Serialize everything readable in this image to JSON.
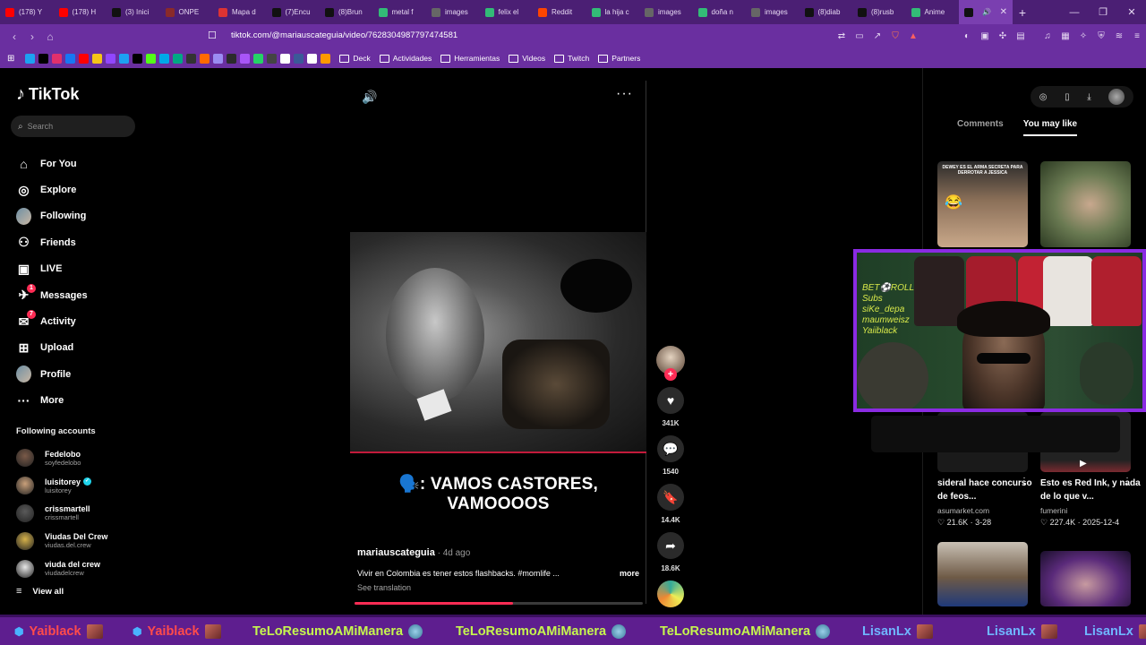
{
  "browser": {
    "tabs": [
      {
        "label": "(178) Y",
        "color": "#ff0000"
      },
      {
        "label": "(178) H",
        "color": "#ff0000"
      },
      {
        "label": "(3) Inici",
        "color": "#111111"
      },
      {
        "label": "ONPE",
        "color": "#8a2a2a"
      },
      {
        "label": "Mapa d",
        "color": "#d33"
      },
      {
        "label": "(7)Encu",
        "color": "#111111"
      },
      {
        "label": "(8)Brun",
        "color": "#111111"
      },
      {
        "label": "metal f",
        "color": "#3b7"
      },
      {
        "label": "images",
        "color": "#666"
      },
      {
        "label": "felix el",
        "color": "#3b7"
      },
      {
        "label": "Reddit",
        "color": "#ff4500"
      },
      {
        "label": "la hija c",
        "color": "#3b7"
      },
      {
        "label": "images",
        "color": "#666"
      },
      {
        "label": "doña n",
        "color": "#3b7"
      },
      {
        "label": "images",
        "color": "#666"
      },
      {
        "label": "(8)diab",
        "color": "#111111"
      },
      {
        "label": "(8)rusb",
        "color": "#111111"
      },
      {
        "label": "Anime",
        "color": "#3b7"
      },
      {
        "label": "",
        "color": "#111111",
        "active": true
      }
    ],
    "url_host": "tiktok.com",
    "url_path": "/@mariauscateguia/video/7628304987797474581",
    "bookmarks": [
      {
        "label": "Deck"
      },
      {
        "label": "Actividades"
      },
      {
        "label": "Herramientas"
      },
      {
        "label": "Videos"
      },
      {
        "label": "Twitch"
      },
      {
        "label": "Partners"
      }
    ]
  },
  "tiktok": {
    "logo": "TikTok",
    "search_placeholder": "Search",
    "nav": [
      {
        "label": "For You",
        "icon": "home-icon"
      },
      {
        "label": "Explore",
        "icon": "compass-icon"
      },
      {
        "label": "Following",
        "icon": "following-avatar"
      },
      {
        "label": "Friends",
        "icon": "friends-icon"
      },
      {
        "label": "LIVE",
        "icon": "live-icon"
      },
      {
        "label": "Messages",
        "icon": "messages-icon",
        "badge": "1"
      },
      {
        "label": "Activity",
        "icon": "activity-icon",
        "badge": "7"
      },
      {
        "label": "Upload",
        "icon": "upload-icon"
      },
      {
        "label": "Profile",
        "icon": "profile-avatar"
      },
      {
        "label": "More",
        "icon": "more-icon"
      }
    ],
    "following_title": "Following accounts",
    "following": [
      {
        "name": "Fedelobo",
        "handle": "soyfedelobo"
      },
      {
        "name": "luisitorey",
        "handle": "luisitorey",
        "verified": true
      },
      {
        "name": "crissmartell",
        "handle": "crissmartell"
      },
      {
        "name": "Viudas Del Crew",
        "handle": "viudas.del.crew"
      },
      {
        "name": "viuda del crew",
        "handle": "viudadelcrew"
      }
    ],
    "view_all": "View all",
    "video": {
      "caption": "🗣️: VAMOS CASTORES, VAMOOOOS",
      "author": "mariauscateguia",
      "ago": " · 4d ago",
      "description": "Vivir en Colombia es tener estos flashbacks. #momlife ...",
      "more": "more",
      "translate": "See translation",
      "progress": 0.55
    },
    "actions": {
      "likes": "341K",
      "comments": "1540",
      "saves": "14.4K",
      "shares": "18.6K"
    },
    "right_panel": {
      "tabs": [
        {
          "label": "Comments"
        },
        {
          "label": "You may like",
          "active": true
        }
      ],
      "thumb1_text": "DEWEY ES EL ARMA SECRETA PARA DERROTAR A JESSICA",
      "rec": [
        {
          "title": "sideral hace concurso de feos...",
          "author": "asumarket.com",
          "likes": "♡ 21.6K",
          "date": "3-28"
        },
        {
          "title": "Esto es Red Ink, y nada de lo que v...",
          "author": "fumerini",
          "likes": "♡ 227.4K",
          "date": "2025-12-4"
        }
      ]
    }
  },
  "webcam": {
    "sign_lines": [
      "BET⚽ROLL",
      "Subs",
      "siKe_depa",
      "maumweisz",
      "Yaiiblack"
    ]
  },
  "ticker": [
    {
      "label": "Yaiblack",
      "color": "#ff4b4b"
    },
    {
      "label": "Yaiblack",
      "color": "#ff4b4b"
    },
    {
      "label": "TeLoResumoAMiManera",
      "color": "#c6f74e"
    },
    {
      "label": "TeLoResumoAMiManera",
      "color": "#c6f74e"
    },
    {
      "label": "TeLoResumoAMiManera",
      "color": "#c6f74e"
    },
    {
      "label": "LisanLx",
      "color": "#6fb6ff"
    },
    {
      "label": "LisanLx",
      "color": "#6fb6ff"
    },
    {
      "label": "LisanLx",
      "color": "#6fb6ff"
    }
  ]
}
